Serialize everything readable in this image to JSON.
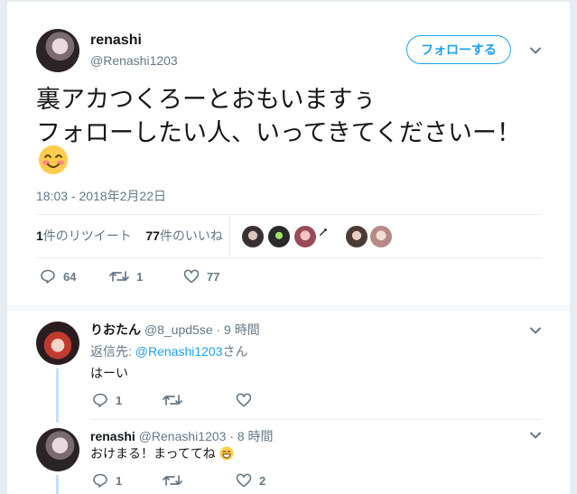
{
  "tweet": {
    "username": "renashi",
    "handle": "@Renashi1203",
    "follow_label": "フォローする",
    "text_line1": "裏アカつくろーとおもいますぅ",
    "text_line2": "フォローしたい人、いってきてくださいー！",
    "emoji": "smiling-face-with-blush",
    "timestamp": "18:03 - 2018年2月22日",
    "retweets_count": "1",
    "retweets_label": "件のリツイート",
    "likes_count": "77",
    "likes_label": "件のいいね",
    "reply_count": "64",
    "retweet_action_count": "1",
    "like_action_count": "77"
  },
  "replies": [
    {
      "name": "りおたん",
      "handle": "@8_upd5se",
      "time": "· 9 時間",
      "reply_prefix": "返信先: ",
      "reply_target": "@Renashi1203",
      "reply_suffix": "さん",
      "text": "はーい",
      "reply_count": "1",
      "retweet_count": "",
      "like_count": ""
    },
    {
      "name": "renashi",
      "handle": "@Renashi1203",
      "time": "· 8 時間",
      "text": "おけまる！まっててね",
      "emoji": "grinning-face",
      "reply_count": "1",
      "retweet_count": "",
      "like_count": "2"
    }
  ],
  "colors": {
    "accent": "#1da1f2",
    "muted": "#657786",
    "text": "#14171a",
    "divider": "#e6ecf0",
    "thread": "#c4dfff"
  }
}
